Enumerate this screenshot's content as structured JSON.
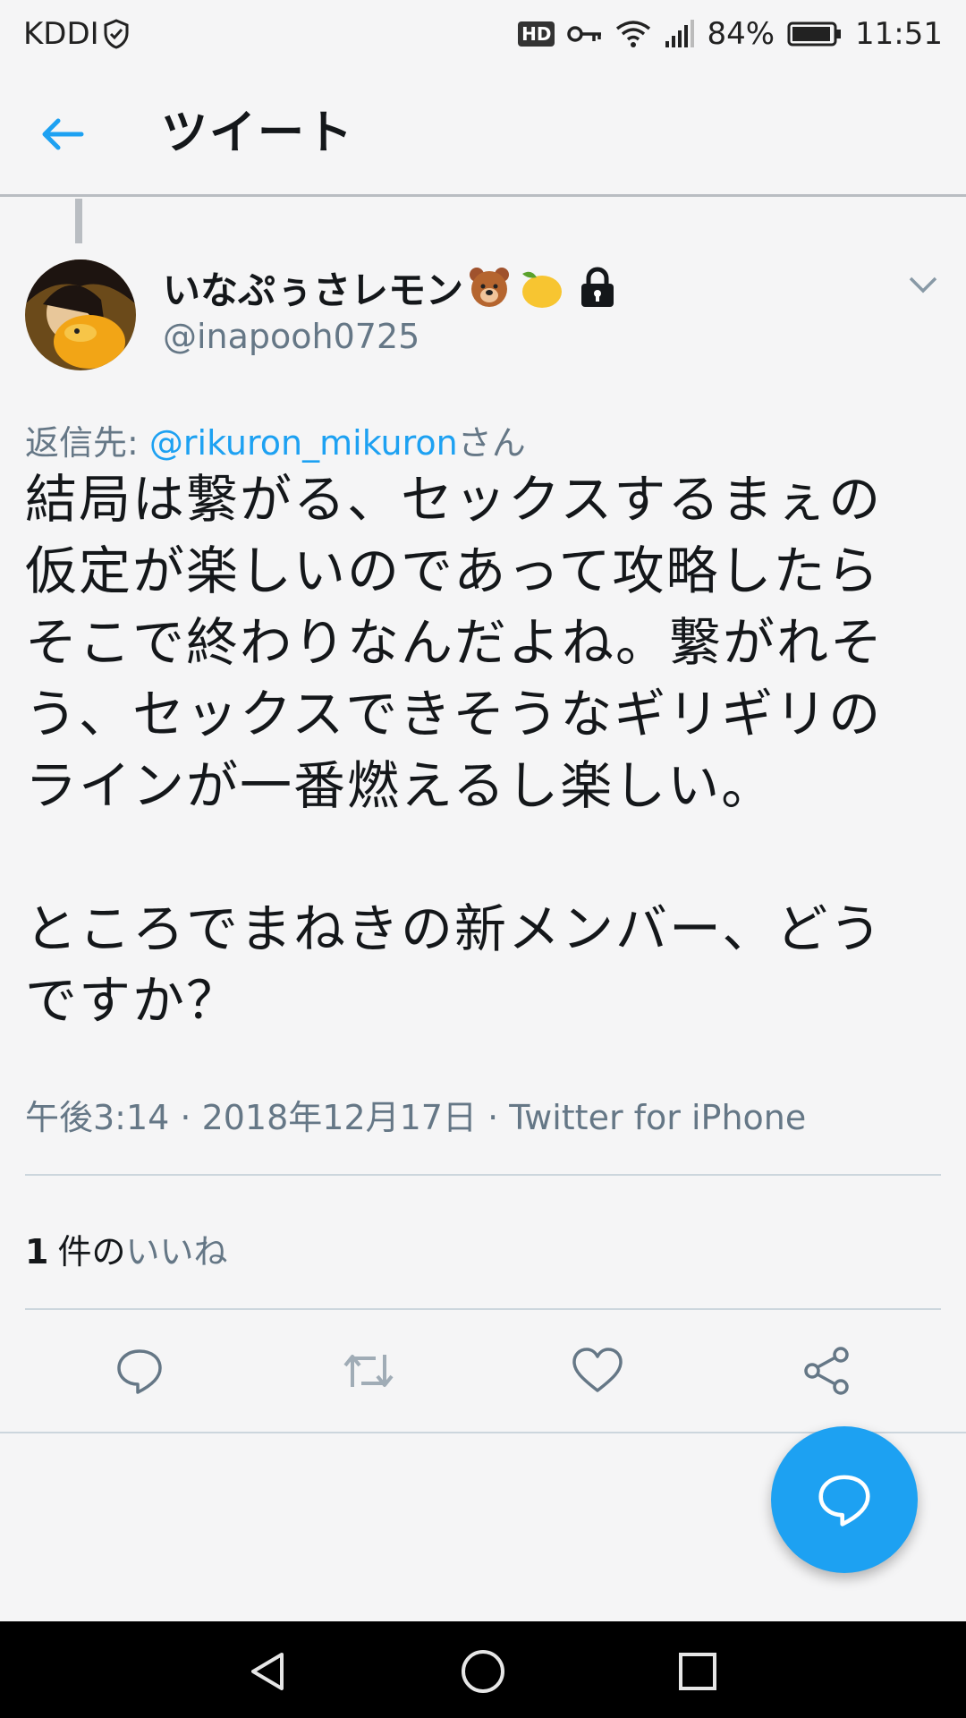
{
  "status_bar": {
    "carrier": "KDDI",
    "hd_badge": "HD",
    "battery_percent": "84%",
    "time": "11:51"
  },
  "header": {
    "title": "ツイート"
  },
  "tweet": {
    "display_name": "いなぷぅさレモン",
    "handle": "@inapooh0725",
    "reply_prefix": "返信先: ",
    "reply_mention": "@rikuron_mikuron",
    "reply_suffix": "さん",
    "text_paragraph_1": "結局は繋がる、セックスするまぇの\n仮定が楽しいのであって攻略したら\nそこで終わりなんだよね。繋がれそ\nう、セックスできそうなギリギリの\nラインが一番燃えるし楽しい。",
    "text_paragraph_2": "ところでまねきの新メンバー、どう\nですか？",
    "meta": "午後3:14 · 2018年12月17日 · Twitter for iPhone",
    "likes_count": "1",
    "likes_label_prefix": "件の",
    "likes_label": "いいね"
  },
  "colors": {
    "accent": "#1da1f2",
    "secondary_text": "#657786"
  }
}
